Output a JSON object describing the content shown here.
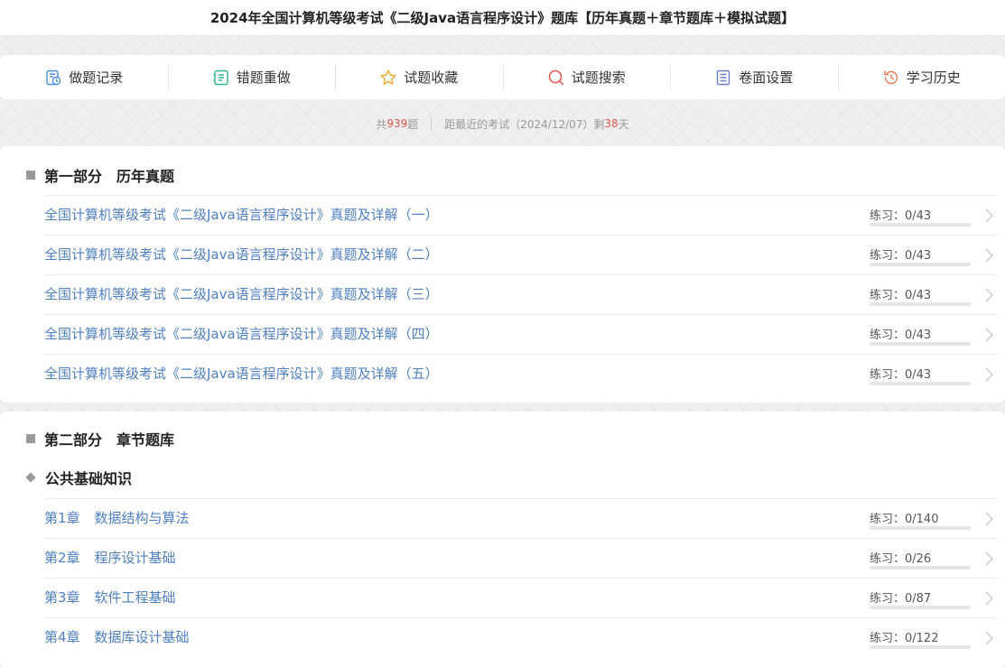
{
  "page_title": "2024年全国计算机等级考试《二级Java语言程序设计》题库【历年真题＋章节题库＋模拟试题】",
  "toolbar": [
    {
      "label": "做题记录",
      "icon": "record-icon",
      "color": "#4a8fd9"
    },
    {
      "label": "错题重做",
      "icon": "redo-icon",
      "color": "#2fb38a"
    },
    {
      "label": "试题收藏",
      "icon": "star-icon",
      "color": "#f0a830"
    },
    {
      "label": "试题搜索",
      "icon": "search-icon",
      "color": "#e5534b"
    },
    {
      "label": "卷面设置",
      "icon": "settings-icon",
      "color": "#6a7fd0"
    },
    {
      "label": "学习历史",
      "icon": "history-icon",
      "color": "#e07a55"
    }
  ],
  "stats": {
    "total_prefix": "共",
    "total": "939",
    "total_suffix": "题",
    "exam_prefix": "距最近的考试（2024/12/07）剩",
    "days": "38",
    "days_suffix": "天"
  },
  "sections": [
    {
      "part": "第一部分",
      "title": "历年真题",
      "rows": [
        {
          "title": "全国计算机等级考试《二级Java语言程序设计》真题及详解（一）",
          "practice": "练习：0/43",
          "progress": 0
        },
        {
          "title": "全国计算机等级考试《二级Java语言程序设计》真题及详解（二）",
          "practice": "练习：0/43",
          "progress": 0
        },
        {
          "title": "全国计算机等级考试《二级Java语言程序设计》真题及详解（三）",
          "practice": "练习：0/43",
          "progress": 0
        },
        {
          "title": "全国计算机等级考试《二级Java语言程序设计》真题及详解（四）",
          "practice": "练习：0/43",
          "progress": 0
        },
        {
          "title": "全国计算机等级考试《二级Java语言程序设计》真题及详解（五）",
          "practice": "练习：0/43",
          "progress": 0
        }
      ]
    },
    {
      "part": "第二部分",
      "title": "章节题库",
      "subsection": "公共基础知识",
      "rows": [
        {
          "chapter": "第1章",
          "title": "数据结构与算法",
          "practice": "练习：0/140",
          "progress": 0
        },
        {
          "chapter": "第2章",
          "title": "程序设计基础",
          "practice": "练习：0/26",
          "progress": 0
        },
        {
          "chapter": "第3章",
          "title": "软件工程基础",
          "practice": "练习：0/87",
          "progress": 0
        },
        {
          "chapter": "第4章",
          "title": "数据库设计基础",
          "practice": "练习：0/122",
          "progress": 0
        }
      ]
    }
  ],
  "colors": {
    "link": "#4f7fbf",
    "highlight": "#e5534b",
    "muted": "#999999"
  }
}
